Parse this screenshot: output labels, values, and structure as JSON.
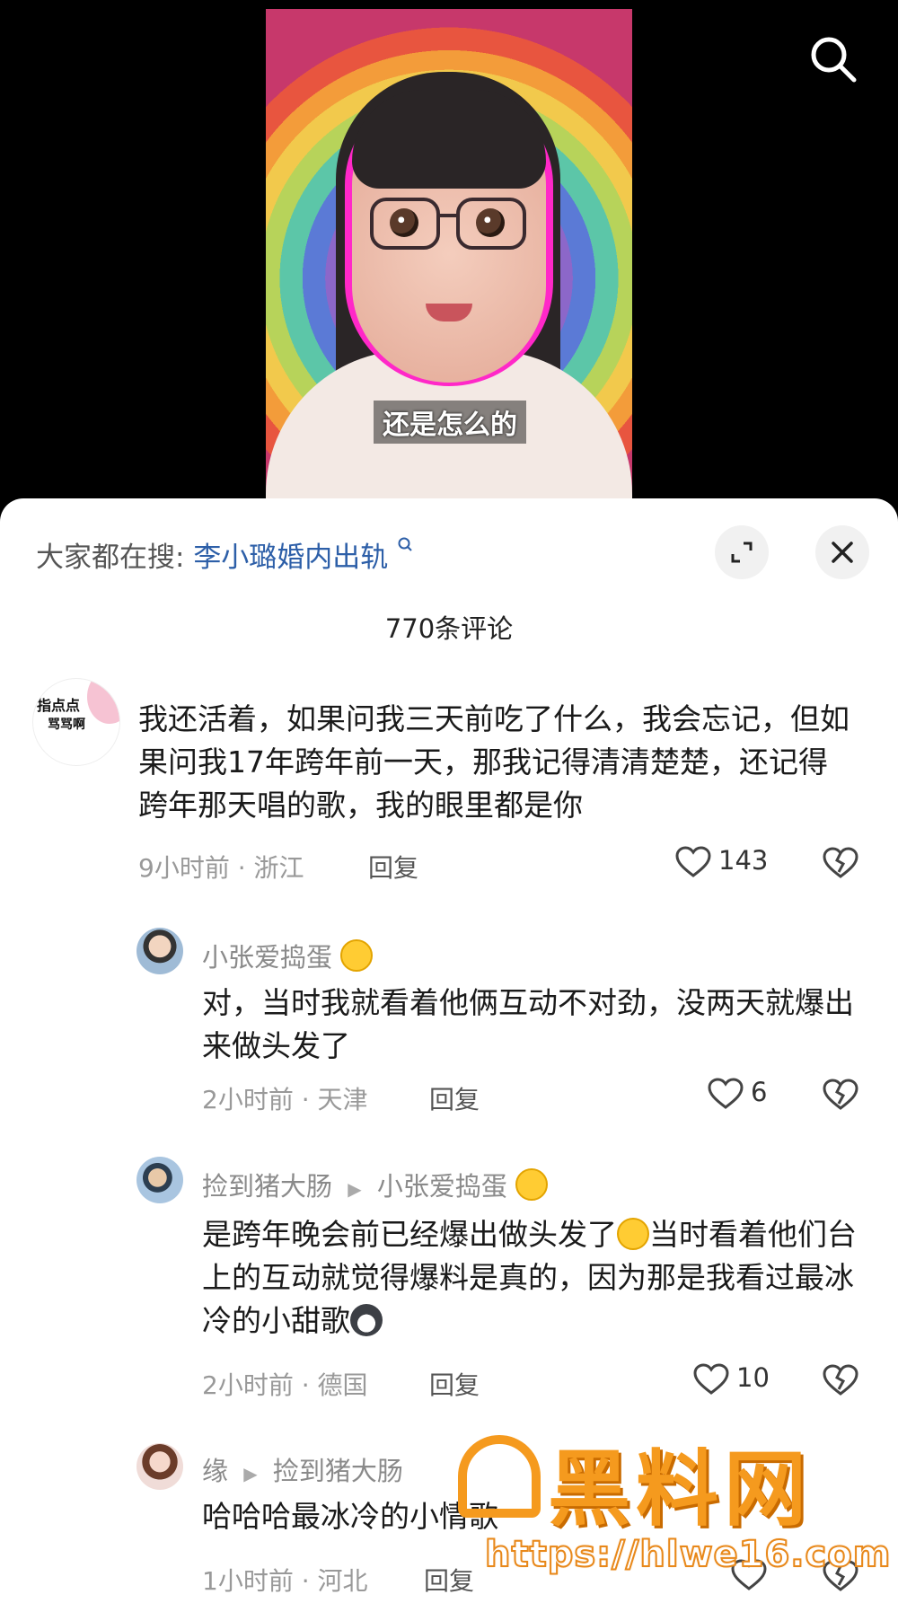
{
  "video": {
    "subtitle": "还是怎么的"
  },
  "search_icon": "search-icon",
  "sheet": {
    "hot_search_prefix": "大家都在搜:",
    "hot_search_term": "李小璐婚内出轨",
    "comment_count": "770条评论"
  },
  "main_comment": {
    "avatar_text_line1": "指点点",
    "avatar_text_line2": "骂骂啊",
    "text": "我还活着，如果问我三天前吃了什么，我会忘记，但如果问我17年跨年前一天，那我记得清清楚楚，还记得跨年那天唱的歌，我的眼里都是你",
    "time_location": "9小时前 · 浙江",
    "reply_label": "回复",
    "likes": "143"
  },
  "replies": [
    {
      "author": "小张爱捣蛋",
      "reply_to": "",
      "text": "对，当时我就看着他俩互动不对劲，没两天就爆出来做头发了",
      "time_location": "2小时前 · 天津",
      "reply_label": "回复",
      "likes": "6"
    },
    {
      "author": "捡到猪大肠",
      "reply_to": "小张爱捣蛋",
      "text_part1": "是跨年晚会前已经爆出做头发了",
      "text_part2": "当时看着他们台上的互动就觉得爆料是真的，因为那是我看过最冰冷的小甜歌",
      "time_location": "2小时前 · 德国",
      "reply_label": "回复",
      "likes": "10"
    },
    {
      "author": "缘",
      "reply_to": "捡到猪大肠",
      "text": "哈哈哈最冰冷的小情歌",
      "time_location": "1小时前 · 河北",
      "reply_label": "回复",
      "likes": ""
    }
  ],
  "watermark": {
    "title": "黑料网",
    "url": "https://hlwe16.com"
  },
  "colors": {
    "link_blue": "#2d5fa8",
    "watermark_orange": "#f59a1e"
  }
}
